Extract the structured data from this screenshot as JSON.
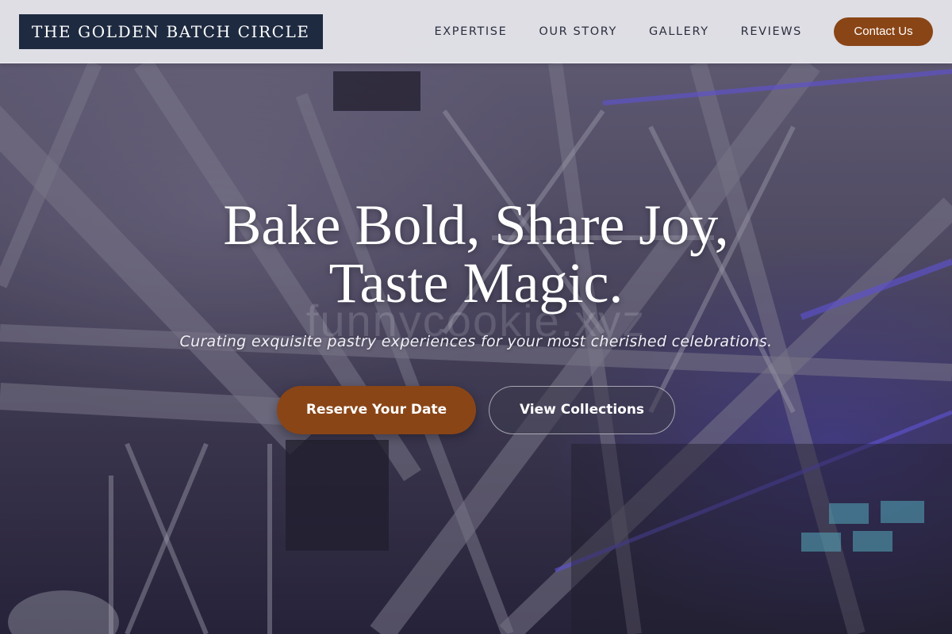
{
  "header": {
    "logo_text": "THE GOLDEN BATCH CIRCLE",
    "nav": [
      {
        "label": "EXPERTISE"
      },
      {
        "label": "OUR STORY"
      },
      {
        "label": "GALLERY"
      },
      {
        "label": "REVIEWS"
      }
    ],
    "contact_label": "Contact Us"
  },
  "hero": {
    "title_line1": "Bake Bold, Share Joy,",
    "title_line2": "Taste Magic.",
    "watermark": "funnycookie.xyz",
    "subtitle": "Curating exquisite pastry experiences for your most cherished celebrations.",
    "primary_cta": "Reserve Your Date",
    "secondary_cta": "View Collections",
    "background": "stage truss rigging photo"
  },
  "colors": {
    "accent": "#8a4516",
    "logo_bg": "#1e2a40",
    "header_bg": "#e8e8ee",
    "nav_text": "#2a2f3e"
  }
}
